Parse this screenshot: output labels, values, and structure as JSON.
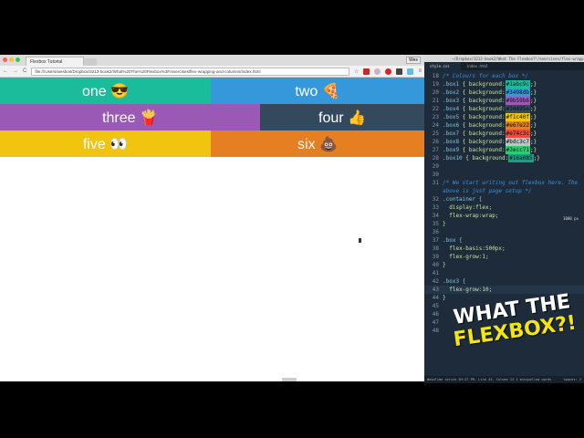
{
  "browser": {
    "tab_title": "Flexbox Tutorial",
    "user": "Wes",
    "url": "file:///Users/wesbos/Dropbox/3213-book2/What%20The%20Flexbox%3F/exercises/flex-wrapping-and-columns/index.html"
  },
  "boxes": [
    {
      "label": "one 😎",
      "color": "#1abc9c"
    },
    {
      "label": "two 🍕",
      "color": "#3498db"
    },
    {
      "label": "three 🍟",
      "color": "#9b59b6"
    },
    {
      "label": "four 👍",
      "color": "#34495e"
    },
    {
      "label": "five 👀",
      "color": "#f1c40f"
    },
    {
      "label": "six 💩",
      "color": "#e67e22"
    }
  ],
  "editor": {
    "title": "~/Dropbox/3213-book2/What The Flexbox?!/exercises/flex-wrapp...",
    "tabs": [
      "style.css",
      "index.html"
    ],
    "comment1": "/* Colours for each box */",
    "colors": [
      {
        "n": "19",
        "sel": ".box1",
        "val": "#1abc9c"
      },
      {
        "n": "20",
        "sel": ".box2",
        "val": "#3498db"
      },
      {
        "n": "21",
        "sel": ".box3",
        "val": "#9b59b6"
      },
      {
        "n": "22",
        "sel": ".box4",
        "val": "#34495e"
      },
      {
        "n": "23",
        "sel": ".box5",
        "val": "#f1c40f"
      },
      {
        "n": "24",
        "sel": ".box6",
        "val": "#e67e22"
      },
      {
        "n": "25",
        "sel": ".box7",
        "val": "#e74c3c"
      },
      {
        "n": "26",
        "sel": ".box8",
        "val": "#bdc3c7"
      },
      {
        "n": "27",
        "sel": ".box9",
        "val": "#2ecc71"
      },
      {
        "n": "28",
        "sel": ".box10",
        "val": "#16a085"
      }
    ],
    "comment2a": "/* We start writing out flexbox here. The",
    "comment2b": "above is just page setup */",
    "container_sel": ".container {",
    "display": "display:flex;",
    "wrap": "flex-wrap:wrap;",
    "box_sel": ".box {",
    "basis": "flex-basis:500px;",
    "grow": "flex-grow:1;",
    "box3_sel": ".box3 {",
    "grow3": "flex-grow:10;",
    "close": "}",
    "px_readout": "1080 px",
    "status_left": "WakaTime active 03:37 PM, Line 43, Column 13  2 misspelled words",
    "status_right": "Spaces: 2"
  },
  "logo": {
    "line1": "WHAT THE",
    "line2": "FLEXBOX?!"
  }
}
